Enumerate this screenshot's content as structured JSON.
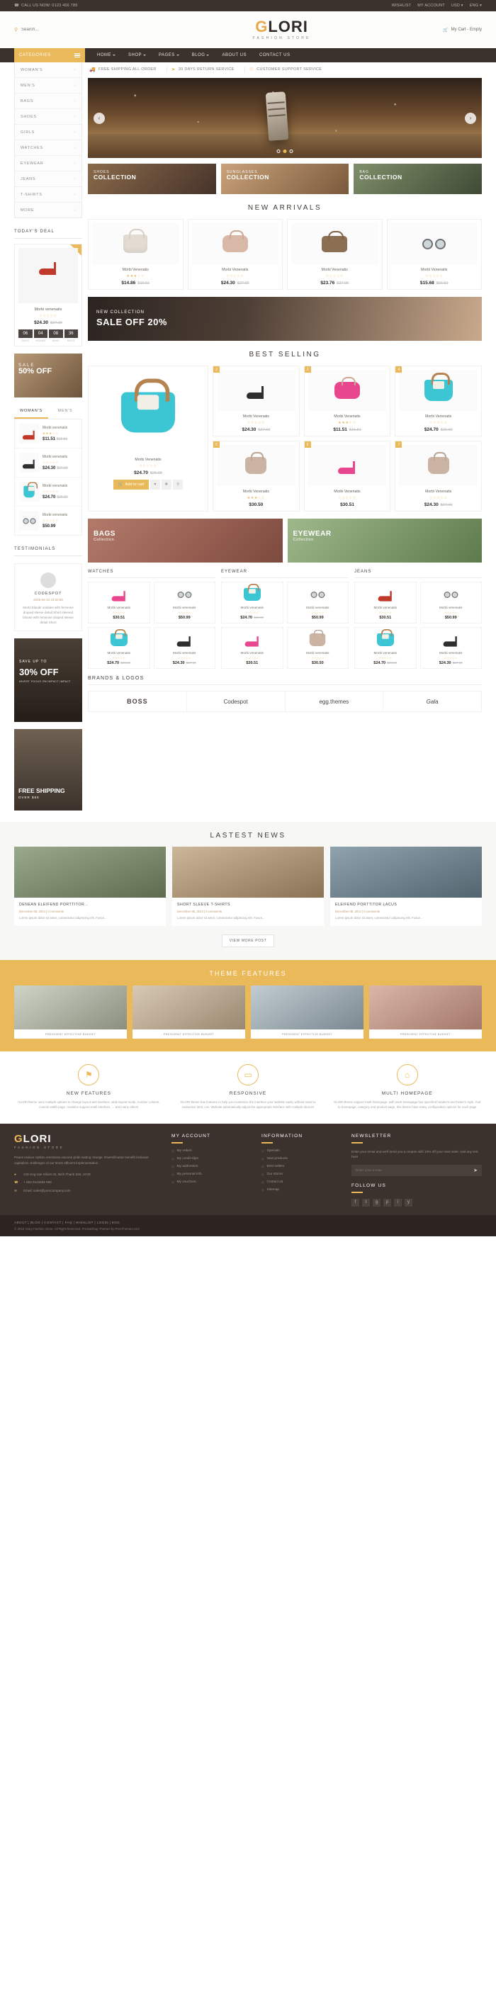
{
  "topbar": {
    "phone": "CALL US NOW: 0123 456 789",
    "links": [
      "WISHLIST",
      "MY ACCOUNT"
    ],
    "currency": "USD",
    "language": "ENG"
  },
  "header": {
    "search_placeholder": "Search...",
    "logo_g": "G",
    "logo_rest": "LORI",
    "logo_sub": "FASHION STORE",
    "cart": "My Cart - Empty"
  },
  "nav": {
    "categories_label": "CATEGORIES",
    "items": [
      "HOME",
      "SHOP",
      "PAGES",
      "BLOG",
      "ABOUT US",
      "CONTACT US"
    ]
  },
  "services": [
    "FREE SHIPPING ALL ORDER",
    "30 DAYS RETURN SERVICE",
    "CUSTOMER SUPPORT SERVICE"
  ],
  "sidebar": {
    "categories": [
      "WOMAN'S",
      "MEN'S",
      "BAGS",
      "SHOES",
      "GIRLS",
      "WATCHES",
      "EYEWEAR",
      "JEANS",
      "T-SHIRTS",
      "MORE"
    ],
    "deal_title": "TODAY'S DEAL",
    "deal": {
      "name": "Morbi venenatis",
      "price": "$24.30",
      "old_price": "$27.00",
      "timer": [
        {
          "num": "06",
          "label": "DAYS"
        },
        {
          "num": "04",
          "label": "HOURS"
        },
        {
          "num": "08",
          "label": "MINS"
        },
        {
          "num": "36",
          "label": "SECS"
        }
      ]
    },
    "sale_left": {
      "small": "SALE",
      "big": "50% OFF"
    },
    "tabs": [
      "WOMAN'S",
      "MEN'S"
    ],
    "mini_products": [
      {
        "name": "Morbi venenatis",
        "price": "$11.51",
        "old_price": "$16.51"
      },
      {
        "name": "Morbi venenatis",
        "price": "$24.30",
        "old_price": "$27.00"
      },
      {
        "name": "Morbi venenatis",
        "price": "$24.70",
        "old_price": "$26.00"
      },
      {
        "name": "Morbi venenatis",
        "price": "$50.99",
        "old_price": ""
      }
    ],
    "testimonial_title": "TESTIMONIALS",
    "testimonial": {
      "name": "CODESPOT",
      "date": "2015-04-12 23:34:56",
      "text": "Morbi blandit sodales with feminine draped sleeve detail Short sleeved blouse with feminine draped sleeve detail Short"
    },
    "save_banner": {
      "top": "SAVE UP TO",
      "big": "30% OFF",
      "sub": "INVEST FOCUS ON IMPACT IMPACT"
    },
    "ship_banner": {
      "big": "FREE SHIPPING",
      "sub": "OVER $80"
    }
  },
  "slider": {
    "prev": "‹",
    "next": "›",
    "dots": 3,
    "active_dot": 1
  },
  "promos": [
    {
      "top": "SHOES",
      "bottom": "COLLECTION"
    },
    {
      "top": "SUNGLASSES",
      "bottom": "COLLECTION"
    },
    {
      "top": "BAG",
      "bottom": "COLLECTION"
    }
  ],
  "new_arrivals": {
    "title": "NEW ARRIVALS",
    "products": [
      {
        "name": "Morbi Venenatis",
        "price": "$14.86",
        "old_price": "$16.51",
        "shape": "bag-a"
      },
      {
        "name": "Morbi Venenatis",
        "price": "$24.30",
        "old_price": "$27.00",
        "shape": "bag-b"
      },
      {
        "name": "Morbi Venenatis",
        "price": "$23.76",
        "old_price": "$27.00",
        "shape": "bag-c"
      },
      {
        "name": "Morbi Venenatis",
        "price": "$15.68",
        "old_price": "$16.51",
        "shape": "glasses"
      }
    ]
  },
  "sale_banner": {
    "top": "NEW COLLECTION",
    "big": "SALE OFF 20%"
  },
  "best_selling": {
    "title": "BEST  SELLING",
    "feature": {
      "name": "Morbi Venenatis",
      "price": "$24.70",
      "old_price": "$26.00",
      "add_to_cart": "Add to cart"
    },
    "products": [
      {
        "badge": "2",
        "name": "Morbi Venenatis",
        "price": "$24.30",
        "old_price": "$27.00",
        "shape": "heel blk"
      },
      {
        "badge": "3",
        "name": "Morbi Venenatis",
        "price": "$11.51",
        "old_price": "$16.51",
        "shape": "bag-b"
      },
      {
        "badge": "4",
        "name": "Morbi Venenatis",
        "price": "$24.70",
        "old_price": "$26.00",
        "shape": "bag-teal"
      },
      {
        "badge": "5",
        "name": "Morbi Venenatis",
        "price": "$30.50",
        "old_price": "",
        "shape": "bag-nude"
      },
      {
        "badge": "6",
        "name": "Morbi Venenatis",
        "price": "$30.51",
        "old_price": "",
        "shape": "heel"
      },
      {
        "badge": "7",
        "name": "Morbi Venenatis",
        "price": "$24.30",
        "old_price": "$27.00",
        "shape": "bag-nude"
      }
    ]
  },
  "two_banners": [
    {
      "big": "BAGS",
      "sub": "Collection"
    },
    {
      "big": "EYEWEAR",
      "sub": "Collection"
    }
  ],
  "cat_columns": [
    {
      "head": "WATCHES",
      "items": [
        {
          "name": "Morbi venenatis",
          "price": "$30.51",
          "old_price": "",
          "shape": "heel"
        },
        {
          "name": "Morbi venenatis",
          "price": "$50.99",
          "old_price": "",
          "shape": "glasses"
        },
        {
          "name": "Morbi venenatis",
          "price": "$24.70",
          "old_price": "$26.00",
          "shape": "bag-teal"
        },
        {
          "name": "Morbi venenatis",
          "price": "$24.30",
          "old_price": "$27.00",
          "shape": "heel blk"
        }
      ]
    },
    {
      "head": "EYEWEAR",
      "items": [
        {
          "name": "Morbi venenatis",
          "price": "$24.70",
          "old_price": "$26.00",
          "shape": "bag-teal"
        },
        {
          "name": "Morbi venenatis",
          "price": "$50.99",
          "old_price": "",
          "shape": "glasses"
        },
        {
          "name": "Morbi venenatis",
          "price": "$30.51",
          "old_price": "",
          "shape": "heel"
        },
        {
          "name": "Morbi venenatis",
          "price": "$30.50",
          "old_price": "",
          "shape": "bag-nude"
        }
      ]
    },
    {
      "head": "JEANS",
      "items": [
        {
          "name": "Morbi venenatis",
          "price": "$30.51",
          "old_price": "",
          "shape": "heel red"
        },
        {
          "name": "Morbi venenatis",
          "price": "$50.99",
          "old_price": "",
          "shape": "glasses"
        },
        {
          "name": "Morbi venenatis",
          "price": "$24.70",
          "old_price": "$26.00",
          "shape": "bag-teal"
        },
        {
          "name": "Morbi venenatis",
          "price": "$24.30",
          "old_price": "$27.00",
          "shape": "heel blk"
        }
      ]
    }
  ],
  "brands": {
    "title": "BRANDS & LOGOS",
    "items": [
      "BOSS",
      "Codespot",
      "egg.themes",
      "Gala"
    ]
  },
  "news": {
    "title": "LASTEST  NEWS",
    "items": [
      {
        "title": "DENEAN ELEIFEND PORTTITOR...",
        "meta": "December 08, 2014  |  0 comments",
        "text": "Lorem ipsum dolor sit amet, consectetur adipiscing elit. Fusce..."
      },
      {
        "title": "SHORT SLEEVE T-SHIRTS",
        "meta": "December 08, 2014  |  0 comments",
        "text": "Lorem ipsum dolor sit amet, consectetur adipiscing elit. Fusce..."
      },
      {
        "title": "ELEIFEND PORTTITOR LACUS",
        "meta": "December 08, 2014  |  0 comments",
        "text": "Lorem ipsum dolor sit amet, consectetur adipiscing elit. Fusce..."
      }
    ],
    "more_button": "VIEW MORE POST"
  },
  "theme_features": {
    "title": "THEME FEATURES",
    "items": [
      {
        "caption": "PRESCIENT EFFECTIVE BUDGET"
      },
      {
        "caption": "PRESCIENT EFFECTIVE BUDGET"
      },
      {
        "caption": "PRESCIENT EFFECTIVE BUDGET"
      },
      {
        "caption": "PRESCIENT EFFECTIVE BUDGET"
      }
    ]
  },
  "features3": [
    {
      "icon": "gift-icon",
      "glyph": "⚑",
      "title": "NEW FEATURES",
      "text": "GLORI theme uses multiple options to change layout and interface, wide-layout mode, number column, custom width page, modules support multi interface, ... and many others"
    },
    {
      "icon": "monitor-icon",
      "glyph": "▭",
      "title": "RESPONSIVE",
      "text": "GLORI theme has features to help you customize the interface your website easily without need to customize html, css. Website automatically adjust the appropriate interface with multiple devices"
    },
    {
      "icon": "home-icon",
      "glyph": "⌂",
      "title": "MULTI HOMEPAGE",
      "text": "GLORI theme support multi homepage, with each homepage has specified header's and footer's style. And to homepage, category and product page, this theme have many configuration options for each page"
    }
  ],
  "footer": {
    "logo_g": "G",
    "logo_rest": "LORI",
    "logo_sub": "FASHION STORE",
    "about": "Peace reduce carbon emissions vaccine pride lasting change. Diversification benefit inclusive capitalism challenges of our times efficient implementation",
    "address": "249 Ung Van Khiem St, Binh Thanh Dist, HCM",
    "phone": "+ 084 0123456 999",
    "email": "Email: sales@yourcompany.com",
    "my_account": {
      "head": "MY ACCOUNT",
      "links": [
        "My orders",
        "My credit slips",
        "My addresses",
        "My personal info",
        "My vouchers"
      ]
    },
    "information": {
      "head": "INFORMATION",
      "links": [
        "Specials",
        "New products",
        "Best sellers",
        "Our stores",
        "Contact us",
        "Sitemap"
      ]
    },
    "newsletter": {
      "head": "NEWSLETTER",
      "text": "Enter your email and we'll send you a coupon with 10% off your next order. Add any text here",
      "placeholder": "Enter your e-mail"
    },
    "follow": {
      "head": "FOLLOW US",
      "icons": [
        "facebook-icon",
        "twitter-icon",
        "google-plus-icon",
        "pinterest-icon",
        "instagram-icon",
        "youtube-icon"
      ],
      "glyphs": [
        "f",
        "t",
        "g",
        "p",
        "i",
        "y"
      ]
    },
    "bottom_links": [
      "ABOUT",
      "BLOG",
      "CONTACT",
      "FAQ",
      "WISHLIST",
      "LOGIN",
      "ENG"
    ],
    "copyright": "© 2015 Glory Fashion Store. All Right Reserved. PrestaShop Themes by PresThemes.com"
  }
}
